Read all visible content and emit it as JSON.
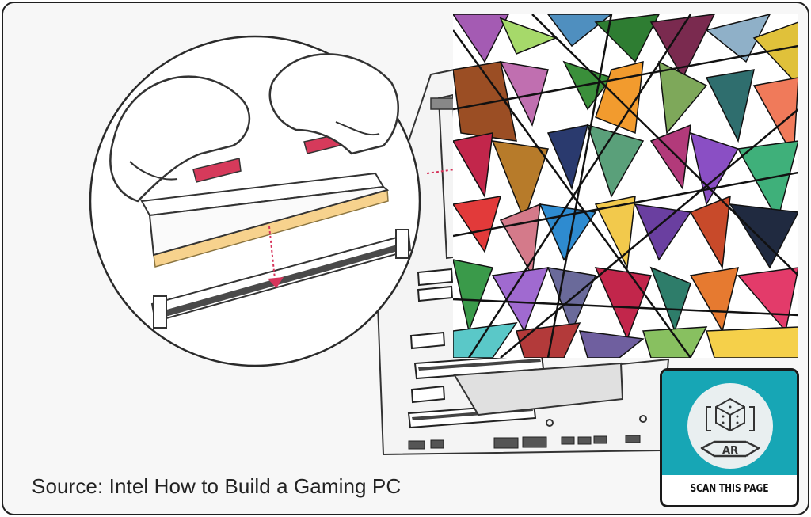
{
  "caption": "Source: Intel How to Build a Gaming PC",
  "ar_badge": {
    "ar_text": "AR",
    "label": "SCAN THIS PAGE",
    "accent_color": "#17a6b5"
  },
  "colors": {
    "ram_gold": "#f7d28d",
    "ram_clip": "#d63a5b",
    "arrow": "#d6335a"
  },
  "icons": [
    "cube-icon",
    "ar-arrow-icon"
  ]
}
